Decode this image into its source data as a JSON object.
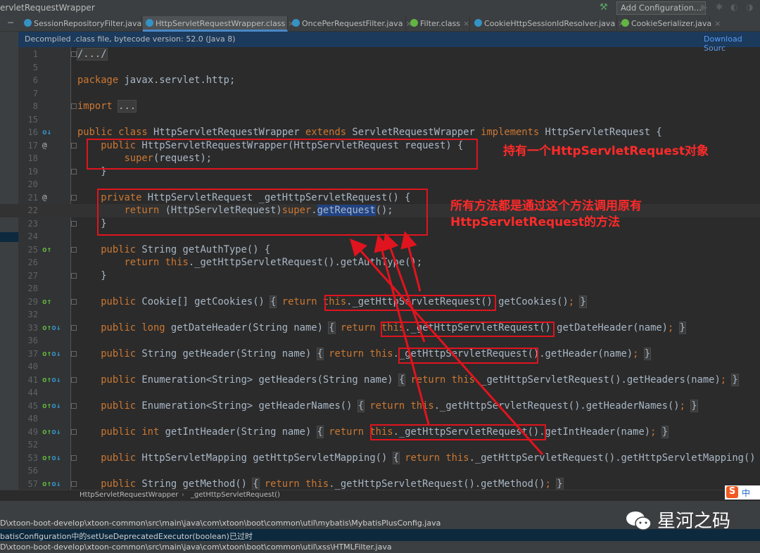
{
  "window": {
    "title": "ervletRequestWrapper",
    "add_configuration": "Add Configuration..."
  },
  "tabs": [
    {
      "label": "SessionRepositoryFilter.java",
      "icon": "class-icon"
    },
    {
      "label": "HttpServletRequestWrapper.class",
      "icon": "class-icon",
      "active": true
    },
    {
      "label": "OncePerRequestFilter.java",
      "icon": "class-icon"
    },
    {
      "label": "Filter.class",
      "icon": "interface-icon"
    },
    {
      "label": "CookieHttpSessionIdResolver.java",
      "icon": "class-icon"
    },
    {
      "label": "CookieSerializer.java",
      "icon": "interface-icon"
    }
  ],
  "banner": {
    "message": "Decompiled .class file, bytecode version: 52.0 (Java 8)",
    "download": "Download Sourc"
  },
  "code": [
    {
      "n": "1",
      "fold": true,
      "t": [
        [
          "f",
          "/.../"
        ]
      ]
    },
    {
      "n": "5",
      "t": []
    },
    {
      "n": "6",
      "t": [
        [
          "k",
          "package"
        ],
        [
          "t",
          " javax.servlet.http;"
        ]
      ]
    },
    {
      "n": "7",
      "t": []
    },
    {
      "n": "8",
      "fold": true,
      "t": [
        [
          "k",
          "import "
        ],
        [
          "f",
          "..."
        ]
      ]
    },
    {
      "n": "15",
      "t": []
    },
    {
      "n": "16",
      "mk": "o↓",
      "t": [
        [
          "k",
          "public class "
        ],
        [
          "t",
          "HttpServletRequestWrapper "
        ],
        [
          "k",
          "extends "
        ],
        [
          "t",
          "ServletRequestWrapper "
        ],
        [
          "k",
          "implements "
        ],
        [
          "t",
          "HttpServletRequest {"
        ]
      ]
    },
    {
      "n": "17",
      "mk": "@",
      "fold": true,
      "t": [
        [
          "t",
          "    "
        ],
        [
          "k",
          "public "
        ],
        [
          "t",
          "HttpServletRequestWrapper(HttpServletRequest request) {"
        ]
      ]
    },
    {
      "n": "18",
      "t": [
        [
          "t",
          "        "
        ],
        [
          "k",
          "super"
        ],
        [
          "t",
          "(request);"
        ]
      ]
    },
    {
      "n": "19",
      "fold": true,
      "t": [
        [
          "t",
          "    }"
        ]
      ]
    },
    {
      "n": "20",
      "t": []
    },
    {
      "n": "21",
      "mk": "@",
      "fold": true,
      "t": [
        [
          "t",
          "    "
        ],
        [
          "k",
          "private "
        ],
        [
          "t",
          "HttpServletRequest _getHttpServletRequest() {"
        ]
      ]
    },
    {
      "n": "22",
      "cur": true,
      "t": [
        [
          "t",
          "        "
        ],
        [
          "k",
          "return "
        ],
        [
          "t",
          "(HttpServletRequest)"
        ],
        [
          "k",
          "super"
        ],
        [
          "t",
          "."
        ],
        [
          "s",
          "getRequest"
        ],
        [
          "t",
          "();"
        ]
      ]
    },
    {
      "n": "23",
      "fold": true,
      "t": [
        [
          "t",
          "    }"
        ]
      ]
    },
    {
      "n": "24",
      "t": []
    },
    {
      "n": "25",
      "mk": "o↑",
      "fold": true,
      "t": [
        [
          "t",
          "    "
        ],
        [
          "k",
          "public "
        ],
        [
          "t",
          "String getAuthType() {"
        ]
      ]
    },
    {
      "n": "26",
      "t": [
        [
          "t",
          "        "
        ],
        [
          "k",
          "return this"
        ],
        [
          "t",
          "._getHttpServletRequest().getAuthType();"
        ]
      ]
    },
    {
      "n": "27",
      "fold": true,
      "t": [
        [
          "t",
          "    }"
        ]
      ]
    },
    {
      "n": "28",
      "t": []
    },
    {
      "n": "29",
      "mk": "o↑",
      "fold": true,
      "t": [
        [
          "t",
          "    "
        ],
        [
          "k",
          "public "
        ],
        [
          "t",
          "Cookie[] getCookies() "
        ],
        [
          "f",
          "{"
        ],
        [
          "t",
          " "
        ],
        [
          "k",
          "return this"
        ],
        [
          "t",
          "._getHttpServletRequest().getCookies()"
        ],
        [
          "k",
          ";"
        ],
        [
          "t",
          " "
        ],
        [
          "f",
          "}"
        ]
      ]
    },
    {
      "n": "32",
      "t": []
    },
    {
      "n": "33",
      "mk": "o↑ o↓",
      "fold": true,
      "t": [
        [
          "t",
          "    "
        ],
        [
          "k",
          "public long "
        ],
        [
          "t",
          "getDateHeader(String name) "
        ],
        [
          "f",
          "{"
        ],
        [
          "t",
          " "
        ],
        [
          "k",
          "return this"
        ],
        [
          "t",
          "._getHttpServletRequest().getDateHeader(name)"
        ],
        [
          "k",
          ";"
        ],
        [
          "t",
          " "
        ],
        [
          "f",
          "}"
        ]
      ]
    },
    {
      "n": "36",
      "t": []
    },
    {
      "n": "37",
      "mk": "o↑ o↓",
      "fold": true,
      "t": [
        [
          "t",
          "    "
        ],
        [
          "k",
          "public "
        ],
        [
          "t",
          "String getHeader(String name) "
        ],
        [
          "f",
          "{"
        ],
        [
          "t",
          " "
        ],
        [
          "k",
          "return this"
        ],
        [
          "t",
          "._getHttpServletRequest().getHeader(name)"
        ],
        [
          "k",
          ";"
        ],
        [
          "t",
          " "
        ],
        [
          "f",
          "}"
        ]
      ]
    },
    {
      "n": "40",
      "t": []
    },
    {
      "n": "41",
      "mk": "o↑ o↓",
      "fold": true,
      "t": [
        [
          "t",
          "    "
        ],
        [
          "k",
          "public "
        ],
        [
          "t",
          "Enumeration<String> getHeaders(String name) "
        ],
        [
          "f",
          "{"
        ],
        [
          "t",
          " "
        ],
        [
          "k",
          "return this"
        ],
        [
          "t",
          "._getHttpServletRequest().getHeaders(name)"
        ],
        [
          "k",
          ";"
        ],
        [
          "t",
          " "
        ],
        [
          "f",
          "}"
        ]
      ]
    },
    {
      "n": "44",
      "t": []
    },
    {
      "n": "45",
      "mk": "o↑ o↓",
      "fold": true,
      "t": [
        [
          "t",
          "    "
        ],
        [
          "k",
          "public "
        ],
        [
          "t",
          "Enumeration<String> getHeaderNames() "
        ],
        [
          "f",
          "{"
        ],
        [
          "t",
          " "
        ],
        [
          "k",
          "return this"
        ],
        [
          "t",
          "._getHttpServletRequest().getHeaderNames()"
        ],
        [
          "k",
          ";"
        ],
        [
          "t",
          " "
        ],
        [
          "f",
          "}"
        ]
      ]
    },
    {
      "n": "48",
      "t": []
    },
    {
      "n": "49",
      "mk": "o↑ o↓",
      "fold": true,
      "t": [
        [
          "t",
          "    "
        ],
        [
          "k",
          "public int "
        ],
        [
          "t",
          "getIntHeader(String name) "
        ],
        [
          "f",
          "{"
        ],
        [
          "t",
          " "
        ],
        [
          "k",
          "return this"
        ],
        [
          "t",
          "._getHttpServletRequest().getIntHeader(name)"
        ],
        [
          "k",
          ";"
        ],
        [
          "t",
          " "
        ],
        [
          "f",
          "}"
        ]
      ]
    },
    {
      "n": "52",
      "t": []
    },
    {
      "n": "53",
      "mk": "o↑ o↓",
      "fold": true,
      "t": [
        [
          "t",
          "    "
        ],
        [
          "k",
          "public "
        ],
        [
          "t",
          "HttpServletMapping getHttpServletMapping() "
        ],
        [
          "f",
          "{"
        ],
        [
          "t",
          " "
        ],
        [
          "k",
          "return this"
        ],
        [
          "t",
          "._getHttpServletRequest().getHttpServletMapping()"
        ]
      ]
    },
    {
      "n": "56",
      "t": []
    },
    {
      "n": "57",
      "mk": "o↑ o↓",
      "fold": true,
      "t": [
        [
          "t",
          "    "
        ],
        [
          "k",
          "public "
        ],
        [
          "t",
          "String getMethod() "
        ],
        [
          "f",
          "{"
        ],
        [
          "t",
          " "
        ],
        [
          "k",
          "return this"
        ],
        [
          "t",
          "._getHttpServletRequest().getMethod()"
        ],
        [
          "k",
          ";"
        ],
        [
          "t",
          " "
        ],
        [
          "f",
          "}"
        ]
      ]
    }
  ],
  "annotations": {
    "note1": "持有一个HttpServletRequest对象",
    "note2_line1": "所有方法都是通过这个方法调用原有",
    "note2_line2": "HttpServletRequest的方法",
    "color": "#e0141e"
  },
  "breadcrumb": [
    "HttpServletRequestWrapper",
    "_getHttpServletRequest()"
  ],
  "messages": [
    "D\\xtoon-boot-develop\\xtoon-common\\src\\main\\java\\com\\xtoon\\boot\\common\\util\\mybatis\\MybatisPlusConfig.java",
    "batisConfiguration中的setUseDeprecatedExecutor(boolean)已过时",
    "D\\xtoon-boot-develop\\xtoon-common\\src\\main\\java\\com\\xtoon\\boot\\common\\util\\xss\\HTMLFilter.java"
  ],
  "watermark": "星河之码",
  "ime": {
    "logo": "S",
    "mode": "中"
  }
}
